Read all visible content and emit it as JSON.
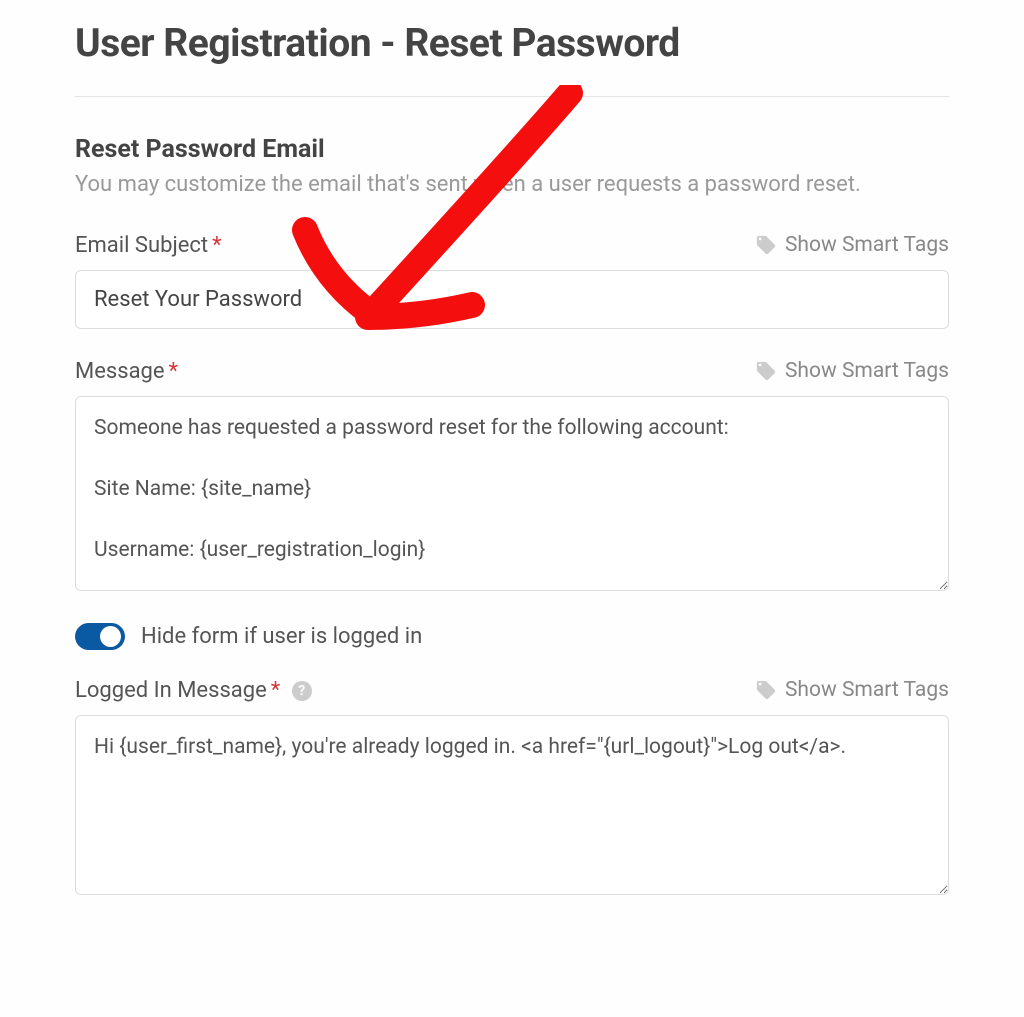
{
  "page_title": "User Registration - Reset Password",
  "section": {
    "title": "Reset Password Email",
    "description": "You may customize the email that's sent when a user requests a password reset."
  },
  "email_subject": {
    "label": "Email Subject",
    "value": "Reset Your Password",
    "smart_tags_label": "Show Smart Tags"
  },
  "message": {
    "label": "Message",
    "value": "Someone has requested a password reset for the following account:\n\nSite Name: {site_name}\n\nUsername: {user_registration_login}",
    "smart_tags_label": "Show Smart Tags"
  },
  "hide_toggle": {
    "label": "Hide form if user is logged in",
    "checked": true
  },
  "logged_in_message": {
    "label": "Logged In Message",
    "value": "Hi {user_first_name}, you're already logged in. <a href=\"{url_logout}\">Log out</a>.",
    "smart_tags_label": "Show Smart Tags"
  }
}
